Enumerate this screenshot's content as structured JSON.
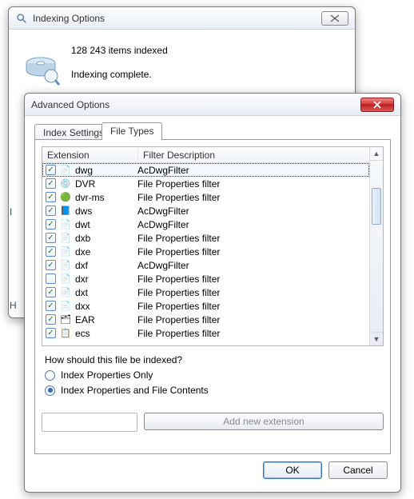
{
  "bg": {
    "title": "Indexing Options",
    "count_line": "128 243 items indexed",
    "status_line": "Indexing complete.",
    "peek_I": "I",
    "peek_H": "H"
  },
  "adv": {
    "title": "Advanced Options",
    "tabs": {
      "settings": "Index Settings",
      "filetypes": "File Types"
    },
    "columns": {
      "ext": "Extension",
      "desc": "Filter Description"
    },
    "rows": [
      {
        "ext": "dwg",
        "desc": "AcDwgFilter",
        "checked": true,
        "icon": "📄",
        "sel": true
      },
      {
        "ext": "DVR",
        "desc": "File Properties filter",
        "checked": true,
        "icon": "💿"
      },
      {
        "ext": "dvr-ms",
        "desc": "File Properties filter",
        "checked": true,
        "icon": "🟢"
      },
      {
        "ext": "dws",
        "desc": "AcDwgFilter",
        "checked": true,
        "icon": "📘"
      },
      {
        "ext": "dwt",
        "desc": "AcDwgFilter",
        "checked": true,
        "icon": "📄"
      },
      {
        "ext": "dxb",
        "desc": "File Properties filter",
        "checked": true,
        "icon": "📄"
      },
      {
        "ext": "dxe",
        "desc": "File Properties filter",
        "checked": true,
        "icon": "📄"
      },
      {
        "ext": "dxf",
        "desc": "AcDwgFilter",
        "checked": true,
        "icon": "📄"
      },
      {
        "ext": "dxr",
        "desc": "File Properties filter",
        "checked": false,
        "icon": "📄"
      },
      {
        "ext": "dxt",
        "desc": "File Properties filter",
        "checked": true,
        "icon": "📄"
      },
      {
        "ext": "dxx",
        "desc": "File Properties filter",
        "checked": true,
        "icon": "📄"
      },
      {
        "ext": "EAR",
        "desc": "File Properties filter",
        "checked": true,
        "icon": "🗂"
      },
      {
        "ext": "ecs",
        "desc": "File Properties filter",
        "checked": true,
        "icon": "📋"
      }
    ],
    "question": "How should this file be indexed?",
    "radio1": "Index Properties Only",
    "radio2": "Index Properties and File Contents",
    "radio_selected": 2,
    "new_ext_placeholder": "",
    "add_btn": "Add new extension",
    "ok": "OK",
    "cancel": "Cancel"
  }
}
